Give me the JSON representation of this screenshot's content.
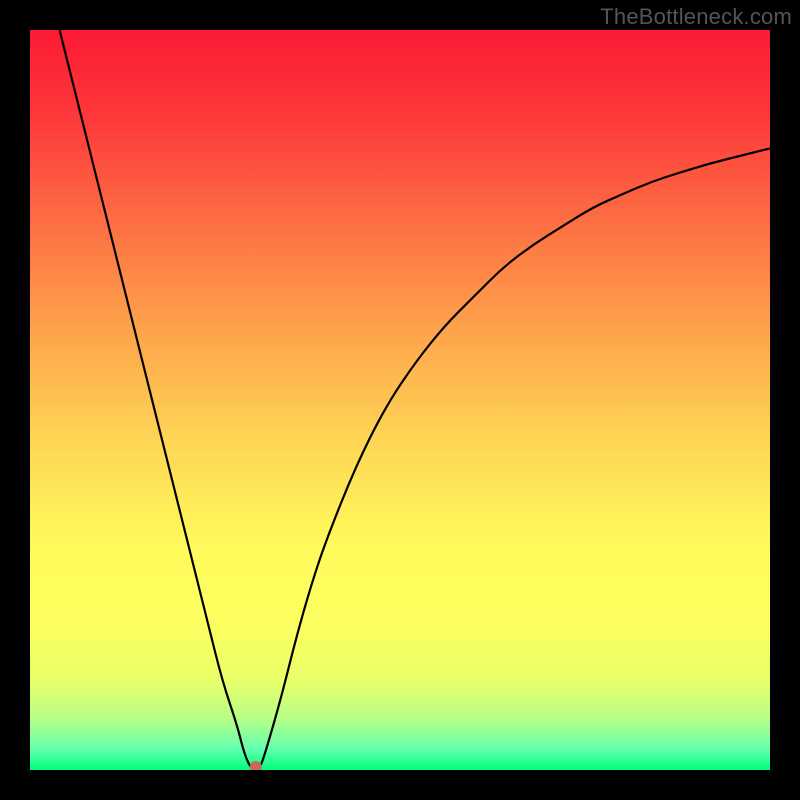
{
  "watermark": "TheBottleneck.com",
  "chart_data": {
    "type": "line",
    "title": "",
    "xlabel": "",
    "ylabel": "",
    "xlim": [
      0,
      100
    ],
    "ylim": [
      0,
      100
    ],
    "x": [
      4,
      6,
      8,
      10,
      12,
      14,
      16,
      18,
      20,
      22,
      24,
      26,
      28,
      29,
      30,
      31,
      32,
      34,
      36,
      38,
      40,
      44,
      48,
      52,
      56,
      60,
      64,
      68,
      72,
      76,
      80,
      84,
      88,
      92,
      96,
      100
    ],
    "y": [
      100,
      92,
      84,
      76,
      68,
      60,
      52,
      44,
      36,
      28,
      20,
      12,
      6,
      2,
      0,
      0,
      3,
      10,
      18,
      25,
      31,
      41,
      49,
      55,
      60,
      64,
      68,
      71,
      73.5,
      76,
      77.8,
      79.5,
      80.8,
      82,
      83,
      84
    ],
    "marker": {
      "x": 30.5,
      "y_value": 0,
      "color": "#c86a5a"
    },
    "gradient_stops": [
      {
        "pos": 0.0,
        "color": "#fc1a34"
      },
      {
        "pos": 0.12,
        "color": "#fd393a"
      },
      {
        "pos": 0.25,
        "color": "#fd6b42"
      },
      {
        "pos": 0.4,
        "color": "#fea14b"
      },
      {
        "pos": 0.55,
        "color": "#fed454"
      },
      {
        "pos": 0.7,
        "color": "#fffb5c"
      },
      {
        "pos": 0.8,
        "color": "#fdff60"
      },
      {
        "pos": 0.88,
        "color": "#e9ff69"
      },
      {
        "pos": 0.93,
        "color": "#b6ff86"
      },
      {
        "pos": 0.97,
        "color": "#69ffad"
      },
      {
        "pos": 1.0,
        "color": "#00ff7f"
      }
    ]
  }
}
